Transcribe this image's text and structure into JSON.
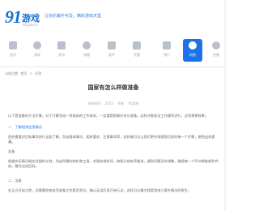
{
  "header": {
    "logo_number": "91",
    "logo_name": "游戏",
    "logo_url": "91yxw.cn",
    "slogan": "让快乐触手可及，精彩游戏天堂"
  },
  "nav": {
    "items": [
      {
        "label": "首页",
        "icon": "home-icon"
      },
      {
        "label": "游戏",
        "icon": "game-icon"
      },
      {
        "label": "资讯",
        "icon": "news-icon"
      },
      {
        "label": "攻略",
        "icon": "guide-icon"
      },
      {
        "label": "软件",
        "icon": "apps-icon"
      },
      {
        "label": "专题",
        "icon": "topic-icon"
      },
      {
        "label": "排行",
        "icon": "rank-icon"
      },
      {
        "label": "问答",
        "icon": "qa-icon",
        "active": true
      },
      {
        "label": "合集",
        "icon": "collection-icon"
      }
    ],
    "active_color": "#1a73e8"
  },
  "breadcrumb": [
    "当前位置",
    "首页",
    ">",
    "问答"
  ],
  "article": {
    "title": "国家有怎么样做准备",
    "meta": [
      "发布时间",
      "2023",
      "作者",
      "91游戏"
    ],
    "paragraphs": [
      "以下是准备的方法步骤，对于打算完成一项具体的工作来说，一定要提前做好充分准备，这样才能保证工作顺利进行，达到预期效果。",
      "一、了解相关信息情况",
      "首先需要对目标事项进行全面了解，包括基本情况、相关要求、注意事项等，这样做可以让我们更好地规划后续的每一个步骤，避免出现遗漏。",
      "准备",
      "根据实际情况制定详细的计划，列出所需的材料和工具，合理安排时间，按照计划有序推进，遇到问题及时调整，确保每一个环节都能顺利完成，最终达成目标。",
      "二、准备",
      "在正式开始之前，还需要检查各项准备工作是否到位，确认无误后再开始行动，这样可以最大程度地减少意外情况的发生。"
    ]
  }
}
